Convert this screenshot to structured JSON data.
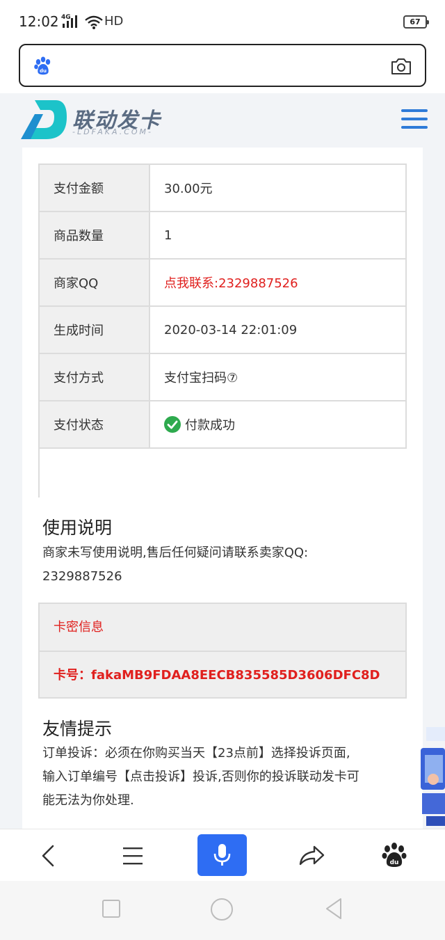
{
  "status_bar": {
    "time": "12:02",
    "network": "4G",
    "hd": "HD",
    "battery": "67"
  },
  "site": {
    "logo_title": "联动发卡",
    "logo_subtitle": "-LDFAKA.COM-"
  },
  "order_table": [
    {
      "label": "支付金额",
      "value": "30.00元",
      "highlight": false
    },
    {
      "label": "商品数量",
      "value": "1",
      "highlight": false
    },
    {
      "label": "商家QQ",
      "value": "点我联系:2329887526",
      "highlight": true
    },
    {
      "label": "生成时间",
      "value": "2020-03-14 22:01:09",
      "highlight": false
    },
    {
      "label": "支付方式",
      "value": "支付宝扫码⑦",
      "highlight": false
    },
    {
      "label": "支付状态",
      "value": "付款成功",
      "highlight": false
    }
  ],
  "usage": {
    "title": "使用说明",
    "text_line1": "商家未写使用说明,售后任何疑问请联系卖家QQ:",
    "text_line2": "2329887526"
  },
  "card_info": {
    "header": "卡密信息",
    "card_number": "卡号：fakaMB9FDAA8EECB835585D3606DFC8D"
  },
  "tips": {
    "title": "友情提示",
    "line1": "订单投诉：必须在你购买当天【23点前】选择投诉页面,",
    "line2": "输入订单编号【点击投诉】投诉,否则你的投诉联动发卡可",
    "line3": "能无法为你处理."
  },
  "colors": {
    "accent_blue": "#2e6df3",
    "alert_red": "#e0201e",
    "success_green": "#2eaa4e",
    "logo_teal": "#1cc3c9"
  }
}
